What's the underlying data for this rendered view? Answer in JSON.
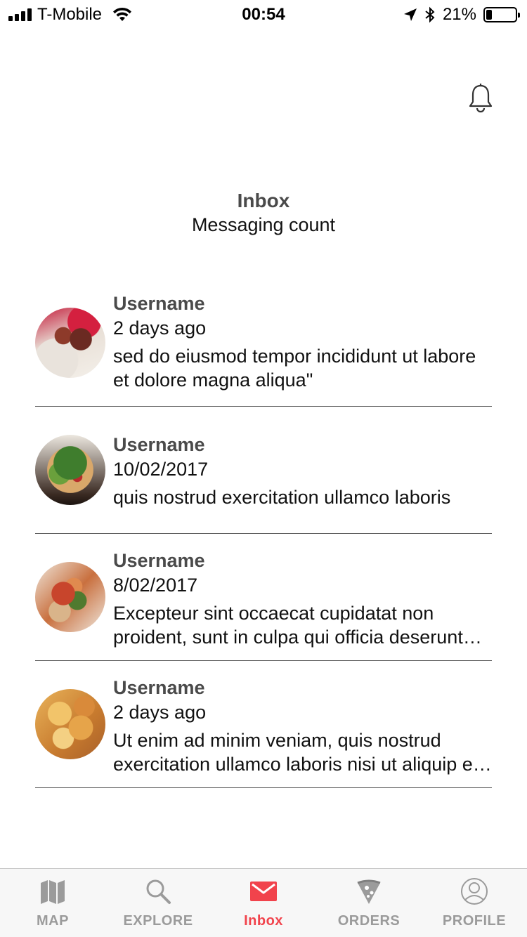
{
  "status_bar": {
    "carrier": "T-Mobile",
    "time": "00:54",
    "battery_percent": "21%",
    "battery_level": 0.21,
    "signal_bars": 4,
    "icons": [
      "signal-icon",
      "wifi-icon",
      "location-icon",
      "bluetooth-icon",
      "battery-icon"
    ]
  },
  "header": {
    "title": "Inbox",
    "subtitle": "Messaging count",
    "bell_icon": "bell-icon"
  },
  "messages": [
    {
      "username": "Username",
      "date": "2 days ago",
      "text": "sed do eiusmod tempor incididunt ut labore et dolore magna aliqua\"",
      "avatar": "food-photo-lamb-chops"
    },
    {
      "username": "Username",
      "date": "10/02/2017",
      "text": "quis nostrud exercitation ullamco laboris",
      "avatar": "food-photo-pizza"
    },
    {
      "username": "Username",
      "date": "8/02/2017",
      "text": "Excepteur sint occaecat cupidatat non proident, sunt in culpa qui officia deserunt mollit anim id est laborum",
      "avatar": "food-photo-salad"
    },
    {
      "username": "Username",
      "date": "2 days ago",
      "text": "Ut enim ad minim veniam, quis nostrud exercitation ullamco laboris nisi ut aliquip ex ea commodo consequat",
      "avatar": "food-photo-mac-and-cheese"
    }
  ],
  "tab_bar": {
    "tabs": [
      {
        "label": "MAP",
        "icon": "map-icon",
        "active": false
      },
      {
        "label": "EXPLORE",
        "icon": "search-icon",
        "active": false
      },
      {
        "label": "Inbox",
        "icon": "envelope-icon",
        "active": true
      },
      {
        "label": "ORDERS",
        "icon": "pizza-icon",
        "active": false
      },
      {
        "label": "PROFILE",
        "icon": "profile-icon",
        "active": false
      }
    ],
    "active_color": "#f1434c",
    "inactive_color": "#9b9b9b"
  }
}
